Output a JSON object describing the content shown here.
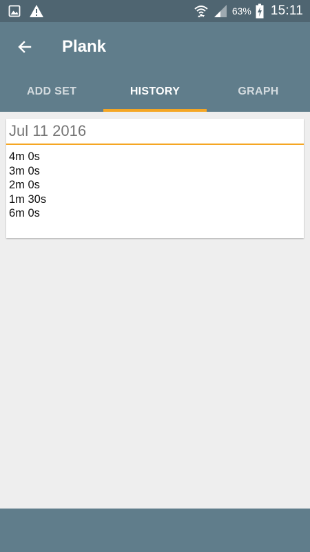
{
  "status_bar": {
    "battery_percent": "63%",
    "time": "15:11",
    "icons": [
      "image-icon",
      "warning-icon",
      "wifi-icon",
      "signal-icon",
      "battery-charging-icon"
    ]
  },
  "app_bar": {
    "title": "Plank",
    "back_icon": "arrow-left-icon"
  },
  "tabs": [
    {
      "label": "ADD SET",
      "active": false
    },
    {
      "label": "HISTORY",
      "active": true
    },
    {
      "label": "GRAPH",
      "active": false
    }
  ],
  "history": {
    "entries": [
      {
        "date": "Jul 11 2016",
        "sets": [
          "4m 0s",
          "3m 0s",
          "2m 0s",
          "1m 30s",
          "6m 0s"
        ]
      }
    ]
  },
  "colors": {
    "primary": "#607d8b",
    "status_bar": "#4f6571",
    "accent": "#f5a623",
    "background": "#eeeeee"
  }
}
